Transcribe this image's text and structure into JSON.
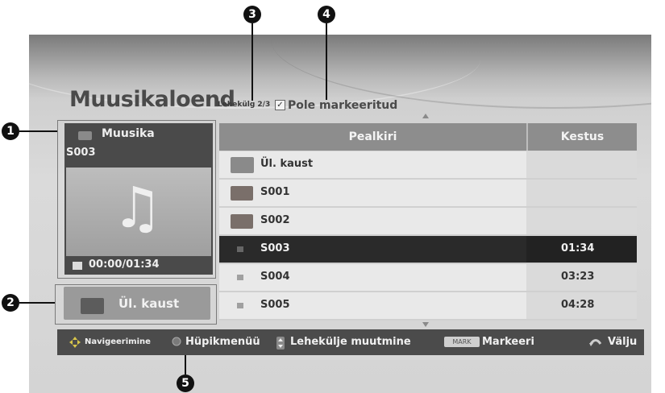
{
  "header": {
    "title": "Muusikaloend",
    "page_info": "Lehekülg 2/3",
    "mark_status": "Pole markeeritud"
  },
  "info_panel": {
    "category": "Muusika",
    "file": "S003",
    "time": "00:00/01:34"
  },
  "up_button": {
    "label": "Ül. kaust"
  },
  "file_list": {
    "columns": [
      "Pealkiri",
      "Kestus"
    ],
    "rows": [
      {
        "name": "Ül. kaust",
        "duration": "",
        "type": "up-folder"
      },
      {
        "name": "S001",
        "duration": "",
        "type": "folder"
      },
      {
        "name": "S002",
        "duration": "",
        "type": "folder"
      },
      {
        "name": "S003",
        "duration": "01:34",
        "type": "file",
        "selected": true
      },
      {
        "name": "S004",
        "duration": "03:23",
        "type": "file"
      },
      {
        "name": "S005",
        "duration": "04:28",
        "type": "file"
      }
    ]
  },
  "nav_bar": {
    "navigate": "Navigeerimine",
    "popup": "Hüpikmenüü",
    "page_change": "Lehekülje muutmine",
    "mark_key": "MARK",
    "mark": "Markeeri",
    "exit": "Välju"
  },
  "callouts": [
    "1",
    "2",
    "3",
    "4",
    "5"
  ],
  "icons": [
    "music-folder-icon",
    "music-note-icon",
    "stop-icon",
    "folder-up-icon",
    "folder-icon",
    "check-icon",
    "navigate-icon",
    "ok-button-icon",
    "page-keys-icon",
    "return-icon"
  ]
}
